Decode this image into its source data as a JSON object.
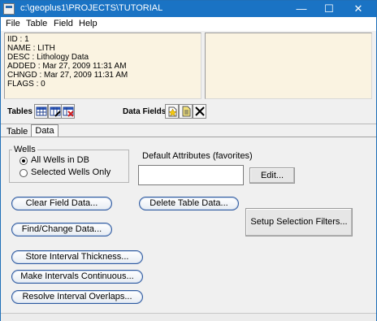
{
  "window": {
    "title": "c:\\geoplus1\\PROJECTS\\TUTORIAL",
    "minimize": "—",
    "maximize": "☐",
    "close": "✕"
  },
  "menu": [
    "File",
    "Table",
    "Field",
    "Help"
  ],
  "info": [
    "IID : 1",
    "NAME : LITH",
    "DESC : Lithology Data",
    "ADDED : Mar 27, 2009 11:31 AM",
    "CHNGD : Mar 27, 2009 11:31 AM",
    "FLAGS : 0"
  ],
  "toolbar": {
    "tables_label": "Tables",
    "fields_label": "Data Fields",
    "table_icons": [
      "table-grid-icon",
      "table-edit-icon",
      "table-delete-icon"
    ],
    "field_icons": [
      "new-field-icon",
      "field-properties-icon",
      "delete-field-icon"
    ]
  },
  "tabs": {
    "table": "Table",
    "data": "Data"
  },
  "wells": {
    "legend": "Wells",
    "options": [
      "All Wells in DB",
      "Selected Wells Only"
    ],
    "selected": "All Wells in DB"
  },
  "default_attributes": {
    "label": "Default Attributes (favorites)",
    "value": "",
    "edit_button": "Edit..."
  },
  "buttons": {
    "clear_field_data": "Clear Field Data...",
    "delete_table_data": "Delete Table Data...",
    "find_change_data": "Find/Change Data...",
    "setup_selection_filters": "Setup Selection Filters...",
    "store_interval_thickness": "Store Interval Thickness...",
    "make_intervals_continuous": "Make Intervals Continuous...",
    "resolve_interval_overlaps": "Resolve Interval Overlaps..."
  }
}
